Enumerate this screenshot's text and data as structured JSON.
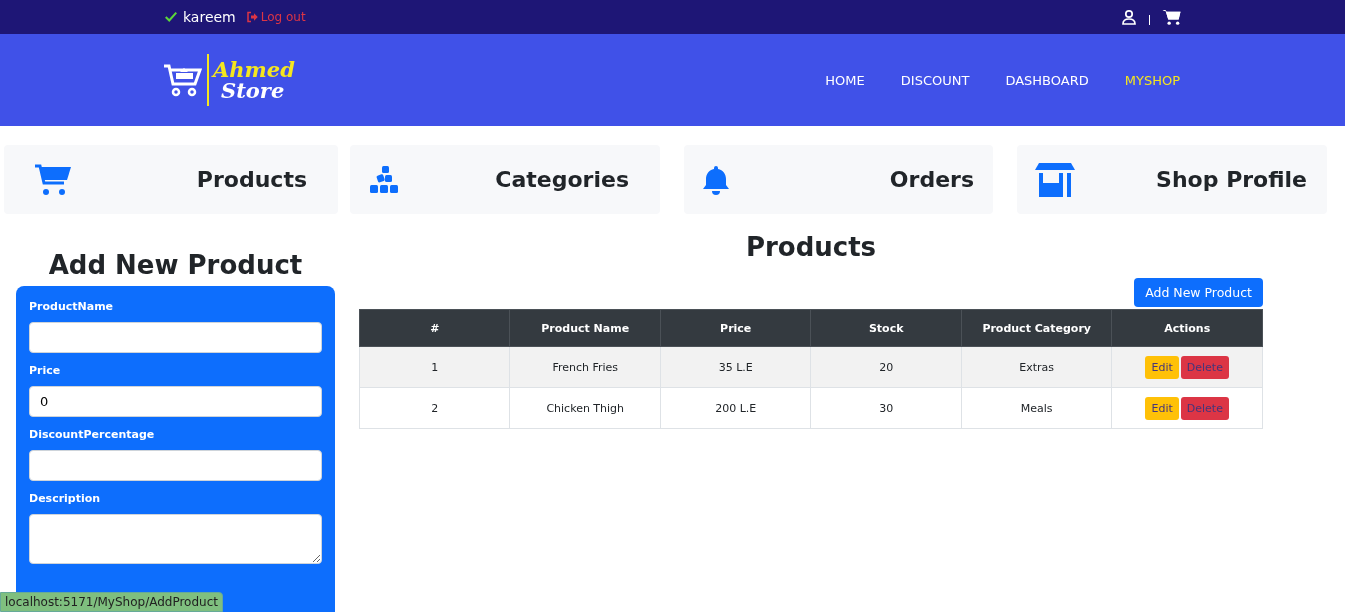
{
  "topbar": {
    "username": "kareem",
    "logout": "Log out"
  },
  "brand": {
    "line1": "Ahmed",
    "line2": "Store"
  },
  "nav": [
    {
      "label": "HOME",
      "selected": false
    },
    {
      "label": "DISCOUNT",
      "selected": false
    },
    {
      "label": "DASHBOARD",
      "selected": false
    },
    {
      "label": "MYSHOP",
      "selected": true
    }
  ],
  "cards": [
    {
      "kind": "cart",
      "label": "Products"
    },
    {
      "kind": "blocks",
      "label": "Categories"
    },
    {
      "kind": "bell",
      "label": "Orders"
    },
    {
      "kind": "shop",
      "label": "Shop Profile"
    }
  ],
  "form": {
    "title": "Add New Product",
    "fields": [
      {
        "kind": "input",
        "label": "ProductName"
      },
      {
        "kind": "input",
        "label": "Price",
        "value": "0"
      },
      {
        "kind": "input",
        "label": "DiscountPercentage"
      },
      {
        "kind": "textarea",
        "label": "Description"
      }
    ]
  },
  "products": {
    "title": "Products",
    "add_button": "Add New Product",
    "columns": [
      "#",
      "Product Name",
      "Price",
      "Stock",
      "Product Category",
      "Actions"
    ],
    "rows": [
      {
        "cells": [
          "1",
          "French Fries",
          "35 L.E",
          "20",
          "Extras"
        ],
        "edit": "Edit",
        "delete": "Delete"
      },
      {
        "cells": [
          "2",
          "Chicken Thigh",
          "200 L.E",
          "30",
          "Meals"
        ],
        "edit": "Edit",
        "delete": "Delete"
      }
    ]
  },
  "status_url": "localhost:5171/MyShop/AddProduct"
}
